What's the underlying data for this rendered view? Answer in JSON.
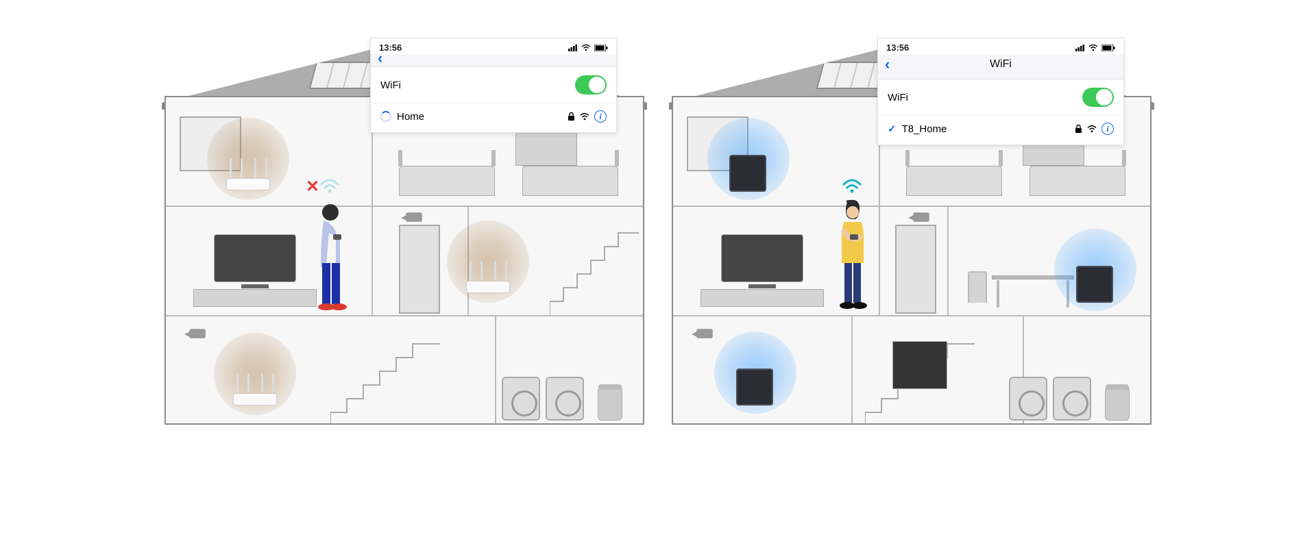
{
  "status_bar": {
    "time": "13:56"
  },
  "left": {
    "nav_title": "",
    "wifi_label": "WiFi",
    "network_name": "Home",
    "signal_quality": "bad",
    "router_type": "old-router"
  },
  "right": {
    "nav_title": "WiFi",
    "wifi_label": "WiFi",
    "network_name": "T8_Home",
    "signal_quality": "good",
    "router_type": "mesh-node"
  },
  "colors": {
    "accent": "#0b6be8",
    "toggle_on": "#3cc956",
    "error": "#e53935",
    "mesh_blue": "#2896ff"
  }
}
